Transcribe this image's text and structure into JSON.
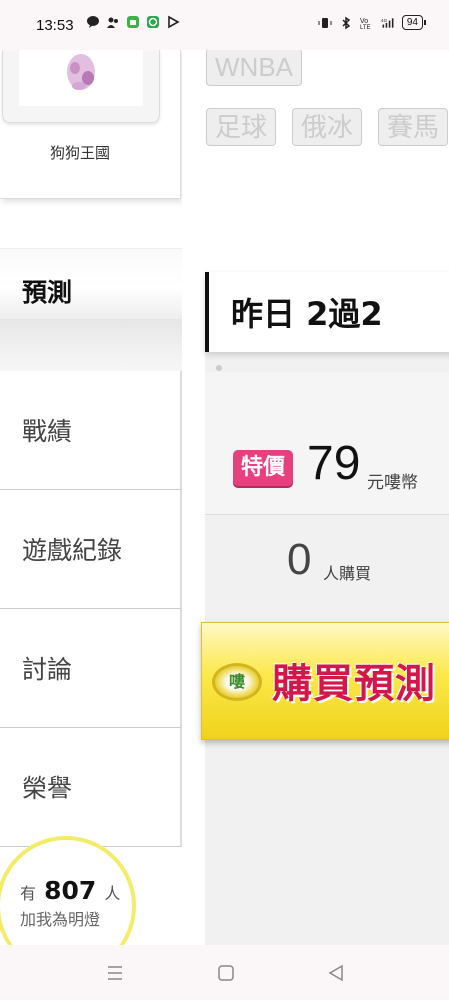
{
  "status_bar": {
    "time": "13:53",
    "notification_icons": [
      "chat-bubble-icon",
      "people-icon",
      "sim-card-icon",
      "app-green-icon",
      "play-outline-icon"
    ],
    "system_icons": [
      "vibrate-icon",
      "bluetooth-icon",
      "volte-icon",
      "signal-4g-icon"
    ],
    "battery": "94"
  },
  "sidebar": {
    "kennel_name": "狗狗王國",
    "nav": {
      "active": "預測",
      "items": [
        "戰績",
        "遊戲紀錄",
        "討論",
        "榮譽"
      ]
    },
    "lamp": {
      "prefix": "有",
      "count": "807",
      "suffix": "人",
      "subtitle": "加我為明燈"
    }
  },
  "main": {
    "league_tags": [
      "WNBA",
      "足球",
      "俄冰",
      "賽馬"
    ],
    "prediction_title": "昨日 2過2",
    "price_badge": "特價",
    "price": "79",
    "currency": "元嘍幣",
    "buyers": "0",
    "buyers_label": "人購買",
    "buy_logo": "嘍",
    "buy_button": "購買預測"
  },
  "colors": {
    "badge_pink": "#e8407f",
    "buy_yellow": "#fce84a",
    "buy_text_red": "#d2184a",
    "lamp_ring": "#f3ec6b"
  }
}
